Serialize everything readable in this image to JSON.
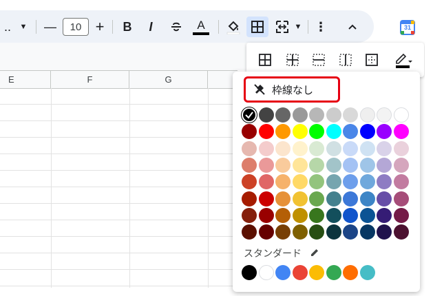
{
  "toolbar": {
    "more_left": "..",
    "minus": "—",
    "font_size": "10",
    "plus": "+",
    "bold": "B",
    "italic": "I",
    "text_color_letter": "A",
    "more_vert": "⋮",
    "collapse": "^",
    "calendar_day": "31",
    "text_color_bar": "#000000",
    "active_bg": "#d3e3fd"
  },
  "columns": [
    "E",
    "F",
    "G"
  ],
  "border_menu": {
    "icons": [
      "all-borders-icon",
      "inner-borders-icon",
      "horizontal-borders-icon",
      "vertical-borders-icon",
      "outer-borders-icon",
      "border-color-pencil-icon"
    ]
  },
  "color_panel": {
    "no_border_label": "枠線なし",
    "highlight_color": "#e60012",
    "standard_label": "スタンダード",
    "palette": [
      [
        "#000000",
        "#434343",
        "#666666",
        "#999999",
        "#b7b7b7",
        "#cccccc",
        "#d9d9d9",
        "#efefef",
        "#f3f3f3",
        "#ffffff"
      ],
      [
        "#980000",
        "#ff0000",
        "#ff9900",
        "#ffff00",
        "#00ff00",
        "#00ffff",
        "#4a86e8",
        "#0000ff",
        "#9900ff",
        "#ff00ff"
      ],
      [
        "#e6b8af",
        "#f4cccc",
        "#fce5cd",
        "#fff2cc",
        "#d9ead3",
        "#d0e0e3",
        "#c9daf8",
        "#cfe2f3",
        "#d9d2e9",
        "#ead1dc"
      ],
      [
        "#dd7e6b",
        "#ea9999",
        "#f9cb9c",
        "#ffe599",
        "#b6d7a8",
        "#a2c4c9",
        "#a4c2f4",
        "#9fc5e8",
        "#b4a7d6",
        "#d5a6bd"
      ],
      [
        "#cc4125",
        "#e06666",
        "#f6b26b",
        "#ffd966",
        "#93c47d",
        "#76a5af",
        "#6d9eeb",
        "#6fa8dc",
        "#8e7cc3",
        "#c27ba0"
      ],
      [
        "#a61c00",
        "#cc0000",
        "#e69138",
        "#f1c232",
        "#6aa84f",
        "#45818e",
        "#3c78d8",
        "#3d85c6",
        "#674ea7",
        "#a64d79"
      ],
      [
        "#85200c",
        "#990000",
        "#b45f06",
        "#bf9000",
        "#38761d",
        "#134f5c",
        "#1155cc",
        "#0b5394",
        "#351c75",
        "#741b47"
      ],
      [
        "#5b0f00",
        "#660000",
        "#783f04",
        "#7f6000",
        "#274e13",
        "#0c343d",
        "#1c4587",
        "#073763",
        "#20124d",
        "#4c1130"
      ]
    ],
    "standard": [
      "#000000",
      "#ffffff",
      "#4285f4",
      "#ea4335",
      "#fbbc04",
      "#34a853",
      "#ff6d01",
      "#46bdc6"
    ]
  }
}
